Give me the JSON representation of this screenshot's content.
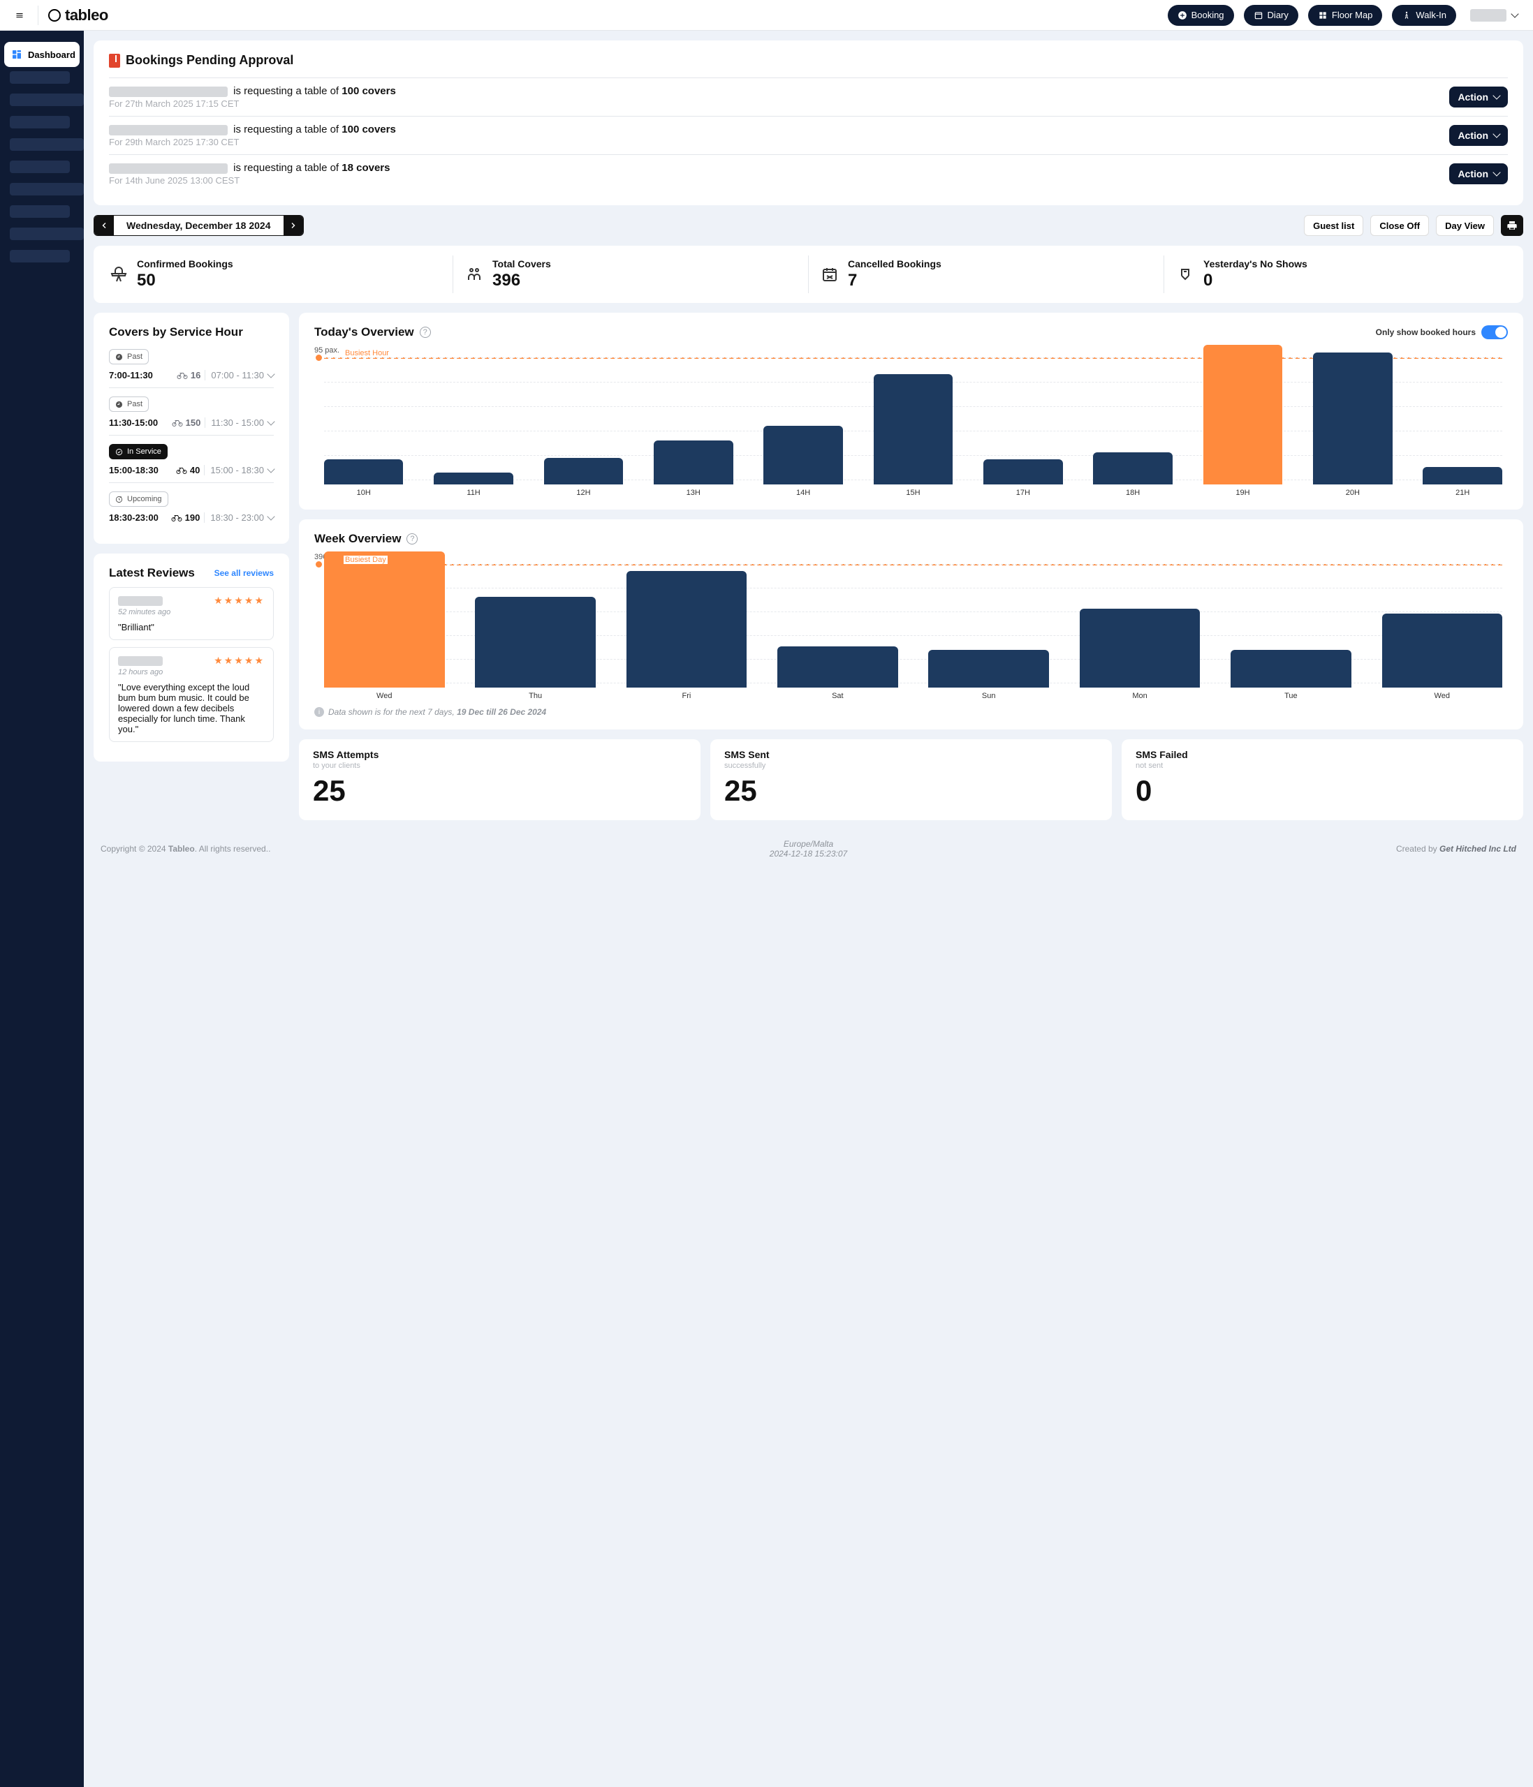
{
  "header": {
    "brand": "tableo",
    "nav": {
      "booking": "Booking",
      "diary": "Diary",
      "floormap": "Floor Map",
      "walkin": "Walk-In"
    }
  },
  "sidebar": {
    "dashboard": "Dashboard"
  },
  "pending": {
    "title": "Bookings Pending Approval",
    "action": "Action",
    "rows": [
      {
        "mid": " is requesting a table of ",
        "covers": "100 covers",
        "sub": "For 27th March 2025 17:15 CET"
      },
      {
        "mid": " is requesting a table of ",
        "covers": "100 covers",
        "sub": "For 29th March 2025 17:30 CET"
      },
      {
        "mid": " is requesting a table of ",
        "covers": "18 covers",
        "sub": "For 14th June 2025 13:00 CEST"
      }
    ]
  },
  "datebar": {
    "date": "Wednesday, December 18 2024",
    "guestlist": "Guest list",
    "closeoff": "Close Off",
    "dayview": "Day View"
  },
  "stats": [
    {
      "label": "Confirmed Bookings",
      "value": "50"
    },
    {
      "label": "Total Covers",
      "value": "396"
    },
    {
      "label": "Cancelled Bookings",
      "value": "7"
    },
    {
      "label": "Yesterday's No Shows",
      "value": "0"
    }
  ],
  "service_hours": {
    "title": "Covers by Service Hour",
    "chips": {
      "past": "Past",
      "in_service": "In Service",
      "upcoming": "Upcoming"
    },
    "rows": [
      {
        "range": "7:00-11:30",
        "covers": "16",
        "select": "07:00 - 11:30"
      },
      {
        "range": "11:30-15:00",
        "covers": "150",
        "select": "11:30 - 15:00"
      },
      {
        "range": "15:00-18:30",
        "covers": "40",
        "select": "15:00 - 18:30"
      },
      {
        "range": "18:30-23:00",
        "covers": "190",
        "select": "18:30 - 23:00"
      }
    ]
  },
  "reviews": {
    "title": "Latest Reviews",
    "see_all": "See all reviews",
    "items": [
      {
        "when": "52 minutes ago",
        "text": "\"Brilliant\"",
        "stars": 5
      },
      {
        "when": "12 hours ago",
        "text": "\"Love everything except the loud bum bum bum music. It could be lowered down a few decibels especially for lunch time. Thank you.\"",
        "stars": 5
      }
    ]
  },
  "today": {
    "title": "Today's Overview",
    "toggle_label": "Only show booked hours",
    "peak": "95 pax.",
    "busiest": "Busiest Hour"
  },
  "week": {
    "title": "Week Overview",
    "peak": "396 pax.",
    "busiest": "Busiest Day",
    "note_a": "Data shown is for the next 7 days, ",
    "note_b": "19 Dec till 26 Dec 2024"
  },
  "sms": [
    {
      "t": "SMS Attempts",
      "s": "to your clients",
      "v": "25"
    },
    {
      "t": "SMS Sent",
      "s": "successfully",
      "v": "25"
    },
    {
      "t": "SMS Failed",
      "s": "not sent",
      "v": "0"
    }
  ],
  "footer": {
    "copy_a": "Copyright © 2024 ",
    "copy_b": "Tableo",
    "copy_c": ". All rights reserved..",
    "tz": "Europe/Malta",
    "ts": "2024-12-18 15:23:07",
    "made_a": "Created by ",
    "made_b": "Get Hitched Inc Ltd"
  },
  "chart_data": [
    {
      "type": "bar",
      "title": "Today's Overview",
      "ylabel": "pax",
      "ylim": [
        0,
        95
      ],
      "categories": [
        "10H",
        "11H",
        "12H",
        "13H",
        "14H",
        "15H",
        "17H",
        "18H",
        "19H",
        "20H",
        "21H"
      ],
      "values": [
        17,
        8,
        18,
        30,
        40,
        75,
        17,
        22,
        95,
        90,
        12
      ],
      "highlight_index": 8,
      "highlight_label": "Busiest Hour",
      "peak_label": "95 pax."
    },
    {
      "type": "bar",
      "title": "Week Overview",
      "ylabel": "pax",
      "ylim": [
        0,
        396
      ],
      "categories": [
        "Wed",
        "Thu",
        "Fri",
        "Sat",
        "Sun",
        "Mon",
        "Tue",
        "Wed"
      ],
      "values": [
        396,
        265,
        340,
        120,
        110,
        230,
        110,
        215
      ],
      "highlight_index": 0,
      "highlight_label": "Busiest Day",
      "peak_label": "396 pax."
    }
  ]
}
